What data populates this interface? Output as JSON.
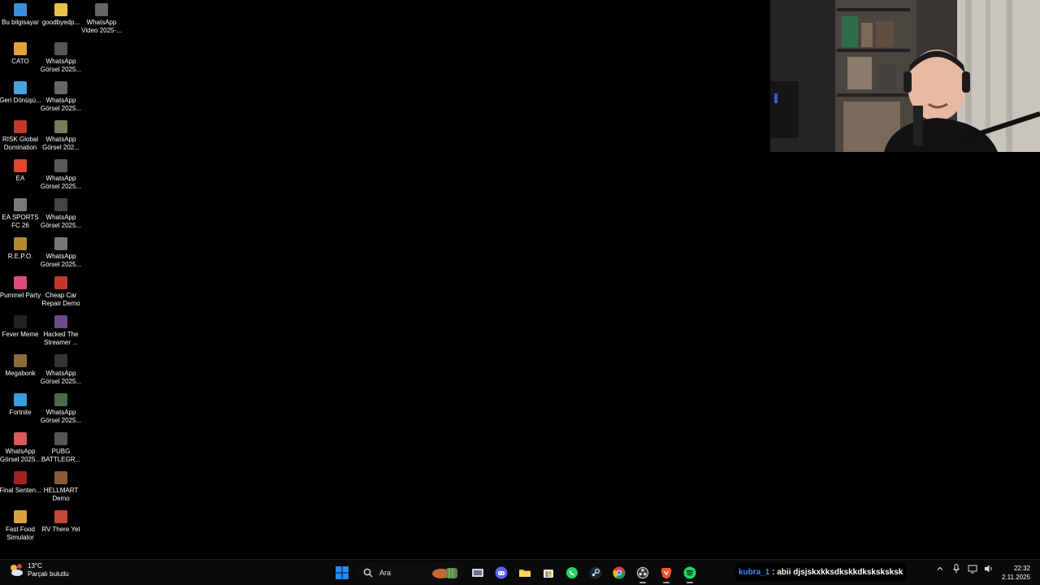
{
  "desktop": {
    "col1": [
      {
        "label": "Bu bilgisayar",
        "icon": "computer-icon",
        "color": "#3a8fd9"
      },
      {
        "label": "CATO",
        "icon": "cato-icon",
        "color": "#e0a33a"
      },
      {
        "label": "Geri Dönüşü...",
        "icon": "recycle-bin-icon",
        "color": "#4aa3df"
      },
      {
        "label": "RISK Global Domination",
        "icon": "risk-game-icon",
        "color": "#c0392b"
      },
      {
        "label": "EA",
        "icon": "ea-icon",
        "color": "#e2452d"
      },
      {
        "label": "EA SPORTS FC 26",
        "icon": "ea-fc-icon",
        "color": "#7a7a7a"
      },
      {
        "label": "R.E.P.O.",
        "icon": "repo-game-icon",
        "color": "#b38a2e"
      },
      {
        "label": "Pummel Party",
        "icon": "pummel-party-icon",
        "color": "#e04a7a"
      },
      {
        "label": "Fever Meme",
        "icon": "fever-meme-icon",
        "color": "#222222"
      },
      {
        "label": "Megabonk",
        "icon": "megabonk-icon",
        "color": "#8e6b3a"
      },
      {
        "label": "Fortnite",
        "icon": "fortnite-icon",
        "color": "#3a9de0"
      },
      {
        "label": "WhatsApp Görsel 2025...",
        "icon": "image-file-icon",
        "color": "#d85a5a"
      },
      {
        "label": "Final Senten...",
        "icon": "final-sentence-icon",
        "color": "#a32020"
      },
      {
        "label": "Fast Food Simulator",
        "icon": "fast-food-simulator-icon",
        "color": "#d9a23a"
      }
    ],
    "col2": [
      {
        "label": "goodbyedp...",
        "icon": "folder-icon",
        "color": "#e8c04a"
      },
      {
        "label": "WhatsApp Görsel 2025...",
        "icon": "image-file-icon",
        "color": "#555555"
      },
      {
        "label": "WhatsApp Görsel 2025...",
        "icon": "image-file-icon",
        "color": "#666666"
      },
      {
        "label": "WhatsApp Görsel 202...",
        "icon": "image-file-icon",
        "color": "#7a7a5a"
      },
      {
        "label": "WhatsApp Görsel 2025...",
        "icon": "image-file-icon",
        "color": "#5a5a5a"
      },
      {
        "label": "WhatsApp Görsel 2025...",
        "icon": "image-file-icon",
        "color": "#444444"
      },
      {
        "label": "WhatsApp Görsel 2025...",
        "icon": "image-file-icon",
        "color": "#777777"
      },
      {
        "label": "Cheap Car Repair Demo",
        "icon": "cheap-car-repair-icon",
        "color": "#c0392b"
      },
      {
        "label": "Hacked The Streamer ...",
        "icon": "hacked-streamer-icon",
        "color": "#6a4a8a"
      },
      {
        "label": "WhatsApp Görsel 2025...",
        "icon": "image-file-icon",
        "color": "#333333"
      },
      {
        "label": "WhatsApp Görsel 2025...",
        "icon": "image-file-icon",
        "color": "#4a6a4a"
      },
      {
        "label": "PUBG BATTLEGR...",
        "icon": "pubg-icon",
        "color": "#555555"
      },
      {
        "label": "HELLMART Demo",
        "icon": "hellmart-icon",
        "color": "#8a5a3a"
      },
      {
        "label": "RV There Yet",
        "icon": "rv-there-yet-icon",
        "color": "#c04a3a"
      }
    ],
    "col3": [
      {
        "label": "WhatsApp Video 2025-...",
        "icon": "video-file-icon",
        "color": "#666666"
      }
    ]
  },
  "taskbar": {
    "weather": {
      "temp": "13°C",
      "condition": "Parçalı bulutlu"
    },
    "search": {
      "placeholder": "Ara"
    },
    "apps": [
      {
        "name": "task-view-button",
        "icon": "task-view-icon",
        "active": false
      },
      {
        "name": "discord-button",
        "icon": "discord-icon",
        "active": false
      },
      {
        "name": "file-explorer-button",
        "icon": "folder-icon",
        "active": false
      },
      {
        "name": "microsoft-store-button",
        "icon": "store-icon",
        "active": false
      },
      {
        "name": "whatsapp-button",
        "icon": "whatsapp-icon",
        "active": false
      },
      {
        "name": "steam-button",
        "icon": "steam-icon",
        "active": false
      },
      {
        "name": "chrome-button",
        "icon": "chrome-icon",
        "active": false
      },
      {
        "name": "obs-button",
        "icon": "obs-icon",
        "active": true
      },
      {
        "name": "brave-button",
        "icon": "brave-icon",
        "active": true
      },
      {
        "name": "spotify-button",
        "icon": "spotify-icon",
        "active": true
      }
    ],
    "chat_overlay": {
      "user": "kubra_1",
      "separator": " : ",
      "message": "abii djsjskxkksdkskkdksksksksk"
    },
    "clock": {
      "time": "22:32",
      "date": "2.11.2025"
    }
  },
  "colors": {
    "taskbar_bg": "#0a0a0a",
    "chat_user": "#3d8bff",
    "windows_blue": "#1e90ff"
  }
}
